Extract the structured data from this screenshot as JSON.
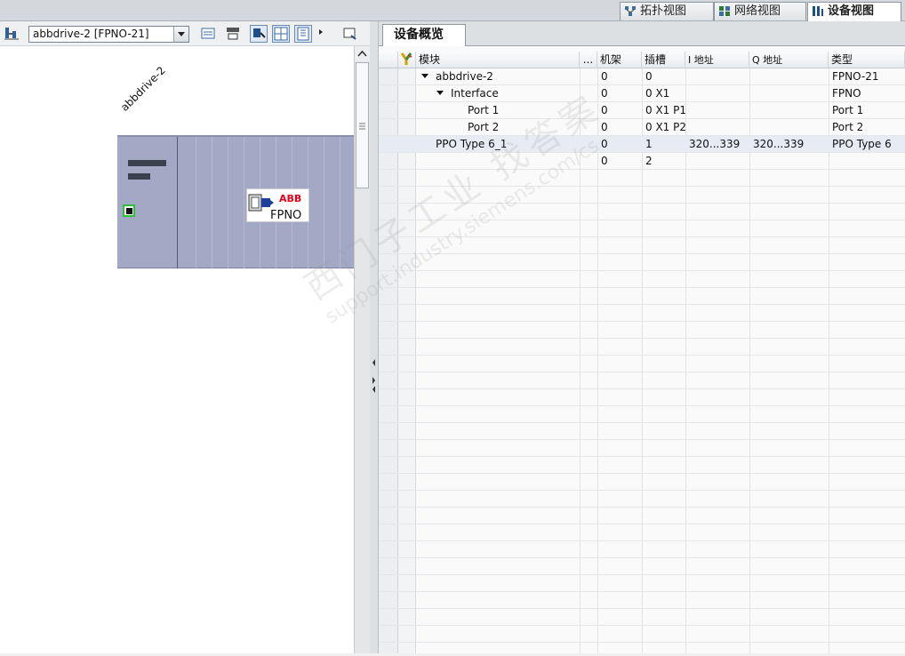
{
  "view_tabs": [
    {
      "label": "拓扑视图",
      "icon": "topology-view-icon"
    },
    {
      "label": "网络视图",
      "icon": "network-view-icon"
    },
    {
      "label": "设备视图",
      "icon": "device-view-icon",
      "active": true
    }
  ],
  "left_toolbar": {
    "device_selector": "abbdrive-2 [FPNO-21]"
  },
  "canvas": {
    "device_name": "abbdrive-2",
    "module_logo_brand": "ABB",
    "module_logo_text": "FPNO"
  },
  "overview": {
    "tab_label": "设备概览",
    "columns": {
      "module": "模块",
      "more": "...",
      "rack": "机架",
      "slot": "插槽",
      "i_address": "I 地址",
      "q_address": "Q 地址",
      "type": "类型"
    },
    "rows": [
      {
        "module": "abbdrive-2",
        "indent": 1,
        "expanded": true,
        "rack": "0",
        "slot": "0",
        "i_address": "",
        "q_address": "",
        "type": "FPNO-21"
      },
      {
        "module": "Interface",
        "indent": 2,
        "expanded": true,
        "rack": "0",
        "slot": "0 X1",
        "i_address": "",
        "q_address": "",
        "type": "FPNO"
      },
      {
        "module": "Port 1",
        "indent": 3,
        "expanded": false,
        "rack": "0",
        "slot": "0 X1 P1",
        "i_address": "",
        "q_address": "",
        "type": "Port 1"
      },
      {
        "module": "Port 2",
        "indent": 3,
        "expanded": false,
        "rack": "0",
        "slot": "0 X1 P2",
        "i_address": "",
        "q_address": "",
        "type": "Port 2"
      },
      {
        "module": "PPO Type 6_1",
        "indent": 1,
        "expanded": false,
        "selected": true,
        "rack": "0",
        "slot": "1",
        "i_address": "320...339",
        "q_address": "320...339",
        "type": "PPO Type 6"
      },
      {
        "module": "",
        "indent": 1,
        "expanded": false,
        "rack": "0",
        "slot": "2",
        "i_address": "",
        "q_address": "",
        "type": ""
      }
    ]
  },
  "watermark": {
    "line1": "西门子工业  找答案",
    "line2": "support.industry.siemens.com/cs"
  },
  "colors": {
    "rack_fill": "#a3a8c5",
    "port_led": "#2fbf3a",
    "abb_red": "#e2001a",
    "selected_row": "#e7ebf3"
  }
}
